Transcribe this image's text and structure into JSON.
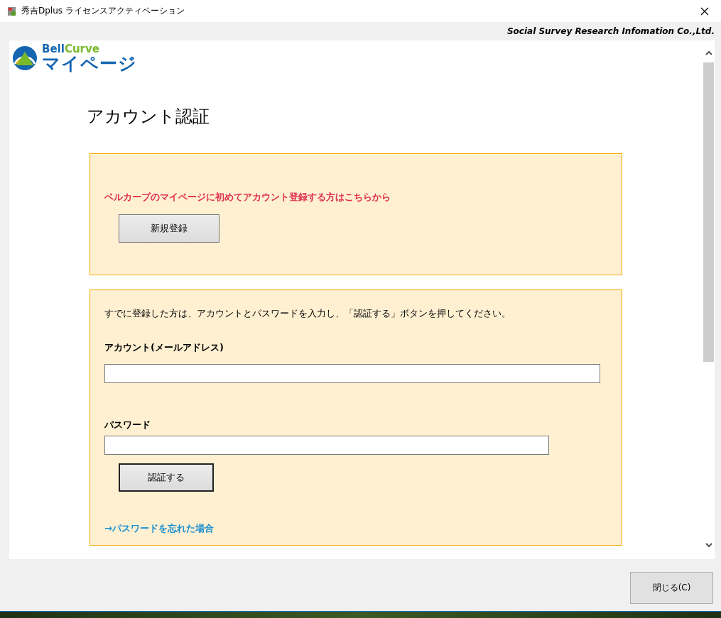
{
  "window": {
    "title": "秀吉Dplus ライセンスアクティベーション"
  },
  "company": "Social Survey Research Infomation Co.,Ltd.",
  "logo": {
    "brand_left": "Bell",
    "brand_right": "Curve",
    "brand_main": "マイページ"
  },
  "heading": "アカウント認証",
  "register_panel": {
    "notice": "ベルカーブのマイページに初めてアカウント登録する方はこちらから",
    "button": "新規登録"
  },
  "login_panel": {
    "instruction": "すでに登録した方は、アカウントとパスワードを入力し、「認証する」ボタンを押してください。",
    "fields": [
      {
        "kind": "email",
        "label": "アカウント(メールアドレス)"
      },
      {
        "kind": "password",
        "label": "パスワード"
      }
    ],
    "button": "認証する",
    "link": "→パスワードを忘れた場合"
  },
  "footer": {
    "button": "閉じる(C)"
  }
}
